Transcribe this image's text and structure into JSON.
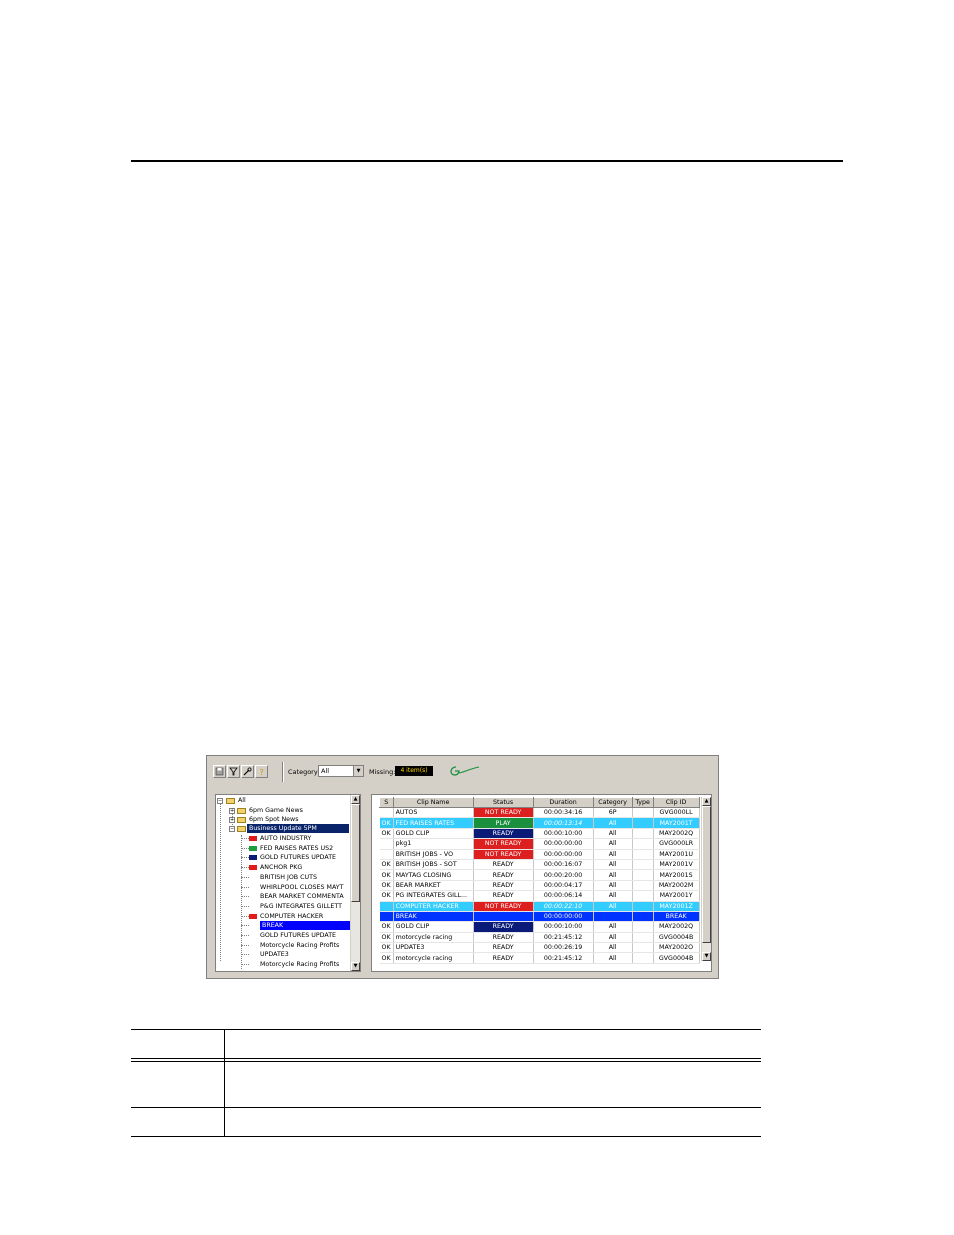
{
  "toolbar": {
    "category_label": "Category:",
    "category_value": "All",
    "missing_label": "Missing:",
    "missing_count": "4 item(s)",
    "buttons": [
      "save-icon",
      "filter-icon",
      "tools-icon",
      "help-icon"
    ]
  },
  "tree": {
    "root": "All",
    "folders": [
      "6pm Game News",
      "6pm Spot News",
      "Business Update 5PM"
    ],
    "items": [
      {
        "label": "AUTO INDUSTRY",
        "color": "#e21b1b"
      },
      {
        "label": "FED RAISES RATES US2",
        "color": "#1a9f3a"
      },
      {
        "label": "GOLD FUTURES UPDATE",
        "color": "#0a1a78"
      },
      {
        "label": "ANCHOR PKG",
        "color": "#e21b1b"
      },
      {
        "label": "BRITISH JOB CUTS",
        "color": ""
      },
      {
        "label": "WHIRLPOOL CLOSES MAYT",
        "color": ""
      },
      {
        "label": "BEAR MARKET COMMENTA",
        "color": ""
      },
      {
        "label": "P&G INTEGRATES GILLETT",
        "color": ""
      },
      {
        "label": "COMPUTER HACKER",
        "color": "#e21b1b"
      },
      {
        "label": "BREAK",
        "color": ""
      },
      {
        "label": "GOLD FUTURES UPDATE",
        "color": ""
      },
      {
        "label": "Motorcycle Racing Profits",
        "color": ""
      },
      {
        "label": "UPDATE3",
        "color": ""
      },
      {
        "label": "Motorcycle Racing Profits",
        "color": ""
      }
    ]
  },
  "grid": {
    "columns": [
      "S",
      "Clip Name",
      "Status",
      "Duration",
      "Category",
      "Type",
      "Clip ID"
    ],
    "rows": [
      {
        "s": "",
        "name": "AUTOS",
        "status": "NOT READY",
        "duration": "00:00:34:16",
        "category": "6P",
        "type": "",
        "id": "GVG000LL",
        "style": ""
      },
      {
        "s": "OK",
        "name": "FED RAISES RATES",
        "status": "PLAY",
        "duration": "00:00:13:14",
        "category": "All",
        "type": "",
        "id": "MAY2001T",
        "style": "cyan"
      },
      {
        "s": "OK",
        "name": "GOLD CLIP",
        "status": "READY",
        "duration": "00:00:10:00",
        "category": "All",
        "type": "",
        "id": "MAY2002Q",
        "style": ""
      },
      {
        "s": "",
        "name": "pkg1",
        "status": "NOT READY",
        "duration": "00:00:00:00",
        "category": "All",
        "type": "",
        "id": "GVG000LR",
        "style": ""
      },
      {
        "s": "",
        "name": "BRITISH JOBS - VO",
        "status": "NOT READY",
        "duration": "00:00:00:00",
        "category": "All",
        "type": "",
        "id": "MAY2001U",
        "style": ""
      },
      {
        "s": "OK",
        "name": "BRITISH JOBS - SOT",
        "status": "READY",
        "duration": "00:00:16:07",
        "category": "All",
        "type": "",
        "id": "MAY2001V",
        "style": ""
      },
      {
        "s": "OK",
        "name": "MAYTAG CLOSING",
        "status": "READY",
        "duration": "00:00:20:00",
        "category": "All",
        "type": "",
        "id": "MAY2001S",
        "style": ""
      },
      {
        "s": "OK",
        "name": "BEAR MARKET",
        "status": "READY",
        "duration": "00:00:04:17",
        "category": "All",
        "type": "",
        "id": "MAY2002M",
        "style": ""
      },
      {
        "s": "OK",
        "name": "PG INTEGRATES GILL...",
        "status": "READY",
        "duration": "00:00:06:14",
        "category": "All",
        "type": "",
        "id": "MAY2001Y",
        "style": ""
      },
      {
        "s": "",
        "name": "COMPUTER HACKER",
        "status": "NOT READY",
        "duration": "00:00:22:10",
        "category": "All",
        "type": "",
        "id": "MAY2001Z",
        "style": "cyan"
      },
      {
        "s": "",
        "name": "BREAK",
        "status": "",
        "duration": "00:00:00:00",
        "category": "",
        "type": "",
        "id": "BREAK",
        "style": "blue"
      },
      {
        "s": "OK",
        "name": "GOLD CLIP",
        "status": "READY",
        "duration": "00:00:10:00",
        "category": "All",
        "type": "",
        "id": "MAY2002Q",
        "style": ""
      },
      {
        "s": "OK",
        "name": "motorcycle racing",
        "status": "READY",
        "duration": "00:21:45:12",
        "category": "All",
        "type": "",
        "id": "GVG0004B",
        "style": ""
      },
      {
        "s": "OK",
        "name": "UPDATE3",
        "status": "READY",
        "duration": "00:00:26:19",
        "category": "All",
        "type": "",
        "id": "MAY2002O",
        "style": ""
      },
      {
        "s": "OK",
        "name": "motorcycle racing",
        "status": "READY",
        "duration": "00:21:45:12",
        "category": "All",
        "type": "",
        "id": "GVG0004B",
        "style": ""
      }
    ]
  },
  "colors": {
    "not_ready": "#dd1f1f",
    "play": "#1a8f3e",
    "ready_dark": "#0a1a78",
    "cyan_row": "#33ccff",
    "blue_row": "#0033ff"
  }
}
